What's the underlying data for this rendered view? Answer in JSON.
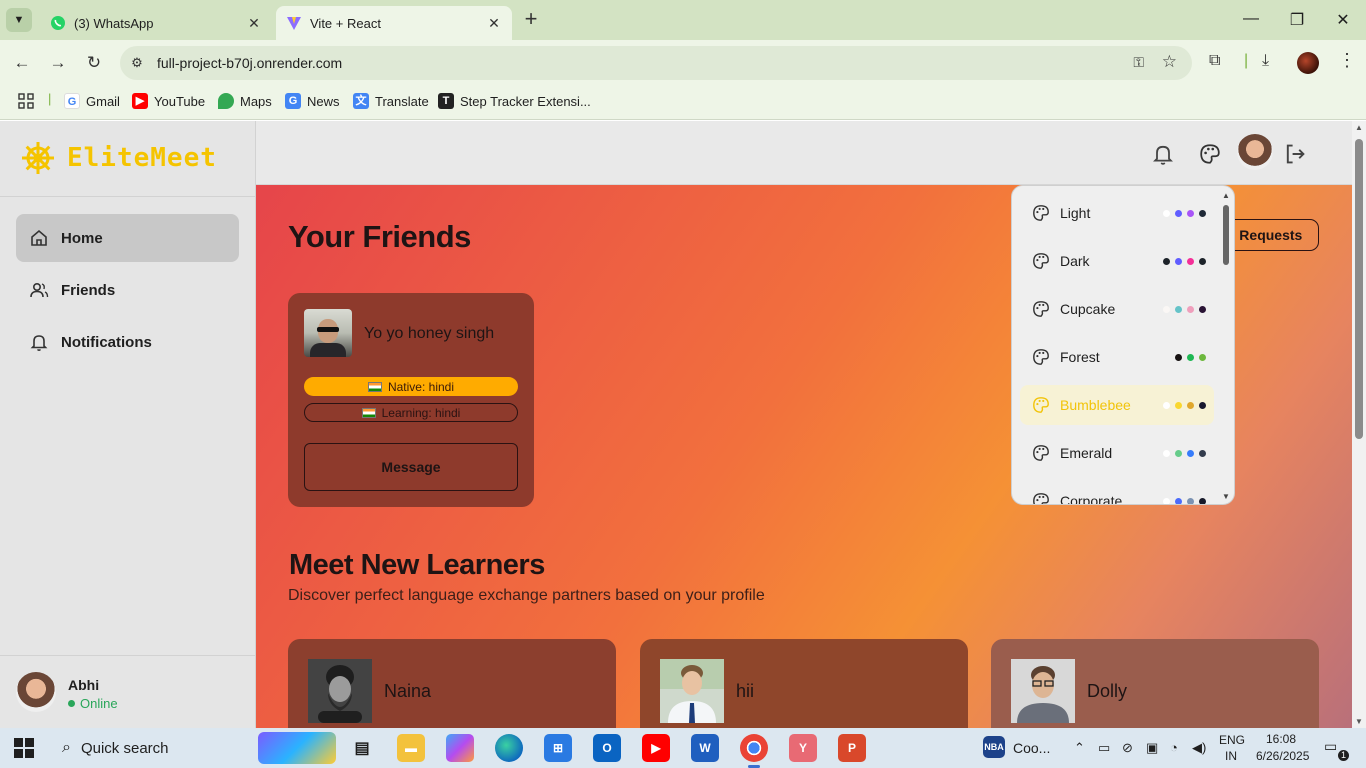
{
  "browser": {
    "tabs": [
      {
        "title": "(3) WhatsApp",
        "icon": "whatsapp-icon",
        "active": false
      },
      {
        "title": "Vite + React",
        "icon": "vite-icon",
        "active": true
      }
    ],
    "url": "full-project-b70j.onrender.com",
    "bookmarks": [
      {
        "label": "Gmail",
        "icon": "google-icon"
      },
      {
        "label": "YouTube",
        "icon": "youtube-icon"
      },
      {
        "label": "Maps",
        "icon": "maps-icon"
      },
      {
        "label": "News",
        "icon": "news-icon"
      },
      {
        "label": "Translate",
        "icon": "translate-icon"
      },
      {
        "label": "Step Tracker Extensi...",
        "icon": "step-tracker-icon"
      }
    ]
  },
  "app": {
    "logo": "EliteMeet",
    "nav": [
      {
        "label": "Home",
        "icon": "home-icon",
        "active": true
      },
      {
        "label": "Friends",
        "icon": "users-icon",
        "active": false
      },
      {
        "label": "Notifications",
        "icon": "bell-icon",
        "active": false
      }
    ],
    "user": {
      "name": "Abhi",
      "status": "Online"
    },
    "colors": {
      "accent": "#f5c400",
      "online": "#2aa65a"
    }
  },
  "main": {
    "friends_title": "Your Friends",
    "friend_requests_label": "Friend Requests",
    "friend": {
      "name": "Yo yo honey singh",
      "native": "Native: hindi",
      "learning": "Learning: hindi",
      "message_label": "Message"
    },
    "meet_title": "Meet New Learners",
    "meet_subtitle": "Discover perfect language exchange partners based on your profile",
    "learners": [
      {
        "name": "Naina"
      },
      {
        "name": "hii"
      },
      {
        "name": "Dolly"
      }
    ]
  },
  "theme_menu": {
    "items": [
      {
        "name": "Light",
        "colors": [
          "#ffffff",
          "#605dff",
          "#a855f7",
          "#1f2937"
        ],
        "selected": false
      },
      {
        "name": "Dark",
        "colors": [
          "#1d232a",
          "#605dff",
          "#f43098",
          "#1d232a"
        ],
        "selected": false
      },
      {
        "name": "Cupcake",
        "colors": [
          "#faf7f5",
          "#65c3c8",
          "#ef9fbc",
          "#291334"
        ],
        "selected": false
      },
      {
        "name": "Forest",
        "colors": [
          "#171212",
          "#1eb854",
          "#6db83d"
        ],
        "selected": false
      },
      {
        "name": "Bumblebee",
        "colors": [
          "#ffffff",
          "#f9d72f",
          "#e0a82e",
          "#181830"
        ],
        "selected": true
      },
      {
        "name": "Emerald",
        "colors": [
          "#ffffff",
          "#66cc8a",
          "#377cfb",
          "#333c4d"
        ],
        "selected": false
      },
      {
        "name": "Corporate",
        "colors": [
          "#ffffff",
          "#4b6bfb",
          "#7b92b2",
          "#181a2a"
        ],
        "selected": false
      }
    ]
  },
  "taskbar": {
    "search": "Quick search",
    "weather": "Coo...",
    "lang": "ENG",
    "region": "IN",
    "time": "16:08",
    "date": "6/26/2025",
    "notif_count": "1"
  }
}
